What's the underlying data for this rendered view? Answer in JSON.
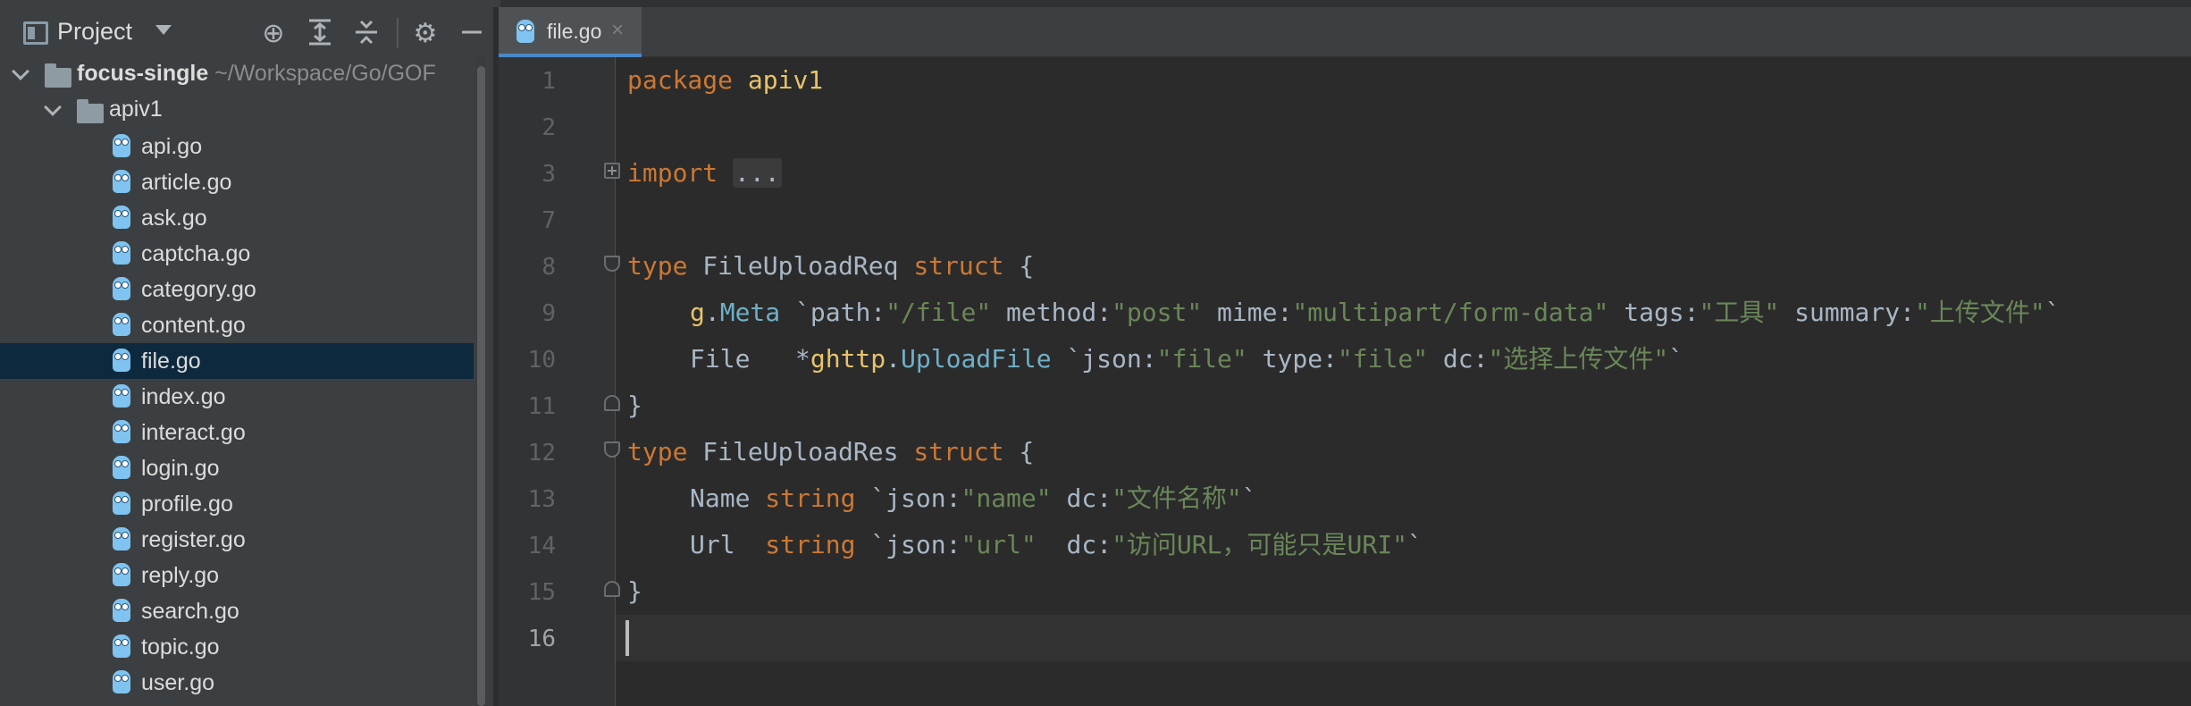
{
  "project_panel": {
    "title": "Project",
    "root": {
      "name": "focus-single",
      "path": "~/Workspace/Go/GOF"
    },
    "folder": "apiv1",
    "files": [
      "api.go",
      "article.go",
      "ask.go",
      "captcha.go",
      "category.go",
      "content.go",
      "file.go",
      "index.go",
      "interact.go",
      "login.go",
      "profile.go",
      "register.go",
      "reply.go",
      "search.go",
      "topic.go",
      "user.go"
    ],
    "selected_file": "file.go"
  },
  "editor": {
    "tab": {
      "label": "file.go",
      "close": "×"
    },
    "line_numbers": [
      "1",
      "2",
      "3",
      "7",
      "8",
      "9",
      "10",
      "11",
      "12",
      "13",
      "14",
      "15",
      "16"
    ],
    "code": {
      "l1_kw": "package",
      "l1_name": " apiv1",
      "l3_kw": "import",
      "l3_folded": "...",
      "l8_kw": "type",
      "l8_name": " FileUploadReq ",
      "l8_struct": "struct",
      "l8_brace": " {",
      "l9_a": "g",
      "l9_b": ".",
      "l9_c": "Meta",
      "l9_d": " `path:",
      "l9_e": "\"/file\"",
      "l9_f": " method:",
      "l9_g": "\"post\"",
      "l9_h": " mime:",
      "l9_i": "\"multipart/form-data\"",
      "l9_j": " tags:",
      "l9_k": "\"工具\"",
      "l9_l": " summary:",
      "l9_m": "\"上传文件\"",
      "l9_n": "`",
      "l10_a": "File   *",
      "l10_b": "ghttp",
      "l10_c": ".",
      "l10_d": "UploadFile",
      "l10_e": " `json:",
      "l10_f": "\"file\"",
      "l10_g": " type:",
      "l10_h": "\"file\"",
      "l10_i": " dc:",
      "l10_j": "\"选择上传文件\"",
      "l10_k": "`",
      "l11": "}",
      "l12_kw": "type",
      "l12_name": " FileUploadRes ",
      "l12_struct": "struct",
      "l12_brace": " {",
      "l13_a": "Name ",
      "l13_b": "string",
      "l13_c": " `json:",
      "l13_d": "\"name\"",
      "l13_e": " dc:",
      "l13_f": "\"文件名称\"",
      "l13_g": "`",
      "l14_a": "Url  ",
      "l14_b": "string",
      "l14_c": " `json:",
      "l14_d": "\"url\"",
      "l14_e": "  dc:",
      "l14_f": "\"访问URL，可能只是URI\"",
      "l14_g": "`",
      "l15": "}"
    }
  },
  "colors": {
    "keyword": "#cc7832",
    "string": "#6a8759",
    "package": "#e8c46a",
    "member": "#6fb0c8",
    "selection": "#0d293e",
    "tab_underline": "#4a88c7"
  },
  "icons": [
    "project-view-icon",
    "locate-icon",
    "expand-all-icon",
    "collapse-all-icon",
    "gear-icon",
    "hide-icon",
    "go-file-icon",
    "folder-icon"
  ]
}
